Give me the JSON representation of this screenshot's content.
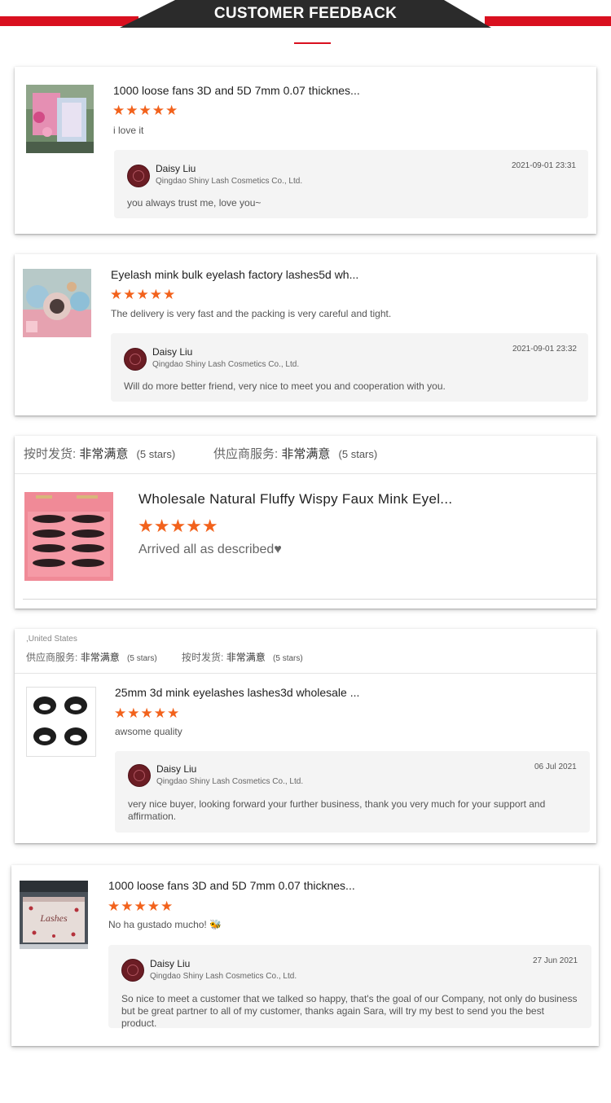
{
  "header": {
    "title": "CUSTOMER FEEDBACK"
  },
  "colors": {
    "accent": "#d9101f",
    "star": "#f2621c",
    "banner": "#2b2b2b"
  },
  "reviews": [
    {
      "product": "1000 loose fans 3D and 5D 7mm 0.07 thicknes...",
      "rating": 5,
      "comment": "i love it",
      "reply": {
        "name": "Daisy Liu",
        "company": "Qingdao Shiny Lash Cosmetics Co., Ltd.",
        "date": "2021-09-01 23:31",
        "text": "you always trust me, love you~"
      }
    },
    {
      "product": "Eyelash mink bulk eyelash factory lashes5d wh...",
      "rating": 5,
      "comment": "The delivery is very fast and the packing is very careful and tight.",
      "reply": {
        "name": "Daisy Liu",
        "company": "Qingdao Shiny Lash Cosmetics Co., Ltd.",
        "date": "2021-09-01 23:32",
        "text": "Will do more better friend, very nice to meet you and cooperation with you."
      }
    },
    {
      "ratings": [
        {
          "label": "按时发货:",
          "value": "非常满意",
          "stars": "(5 stars)"
        },
        {
          "label": "供应商服务:",
          "value": "非常满意",
          "stars": "(5 stars)"
        }
      ],
      "product": "Wholesale Natural Fluffy Wispy Faux Mink Eyel...",
      "rating": 5,
      "comment": "Arrived all as described♥"
    },
    {
      "country": ",United States",
      "ratings": [
        {
          "label": "供应商服务:",
          "value": "非常满意",
          "stars": "(5 stars)"
        },
        {
          "label": "按时发货:",
          "value": "非常满意",
          "stars": "(5 stars)"
        }
      ],
      "product": "25mm 3d mink eyelashes lashes3d wholesale ...",
      "rating": 5,
      "comment": "awsome quality",
      "reply": {
        "name": "Daisy Liu",
        "company": "Qingdao Shiny Lash Cosmetics Co., Ltd.",
        "date": "06 Jul 2021",
        "text": "very nice buyer, looking forward your further business, thank you very much for your support and affirmation."
      }
    },
    {
      "product": "1000 loose fans 3D and 5D 7mm 0.07 thicknes...",
      "rating": 5,
      "comment": "No ha gustado mucho! 🐝",
      "reply": {
        "name": "Daisy Liu",
        "company": "Qingdao Shiny Lash Cosmetics Co., Ltd.",
        "date": "27 Jun 2021",
        "text": "So nice to meet a customer that we talked so happy, that's the goal of our Company, not only do business but be great partner to all of my customer, thanks again Sara, will try my best to send you the best product."
      }
    }
  ]
}
